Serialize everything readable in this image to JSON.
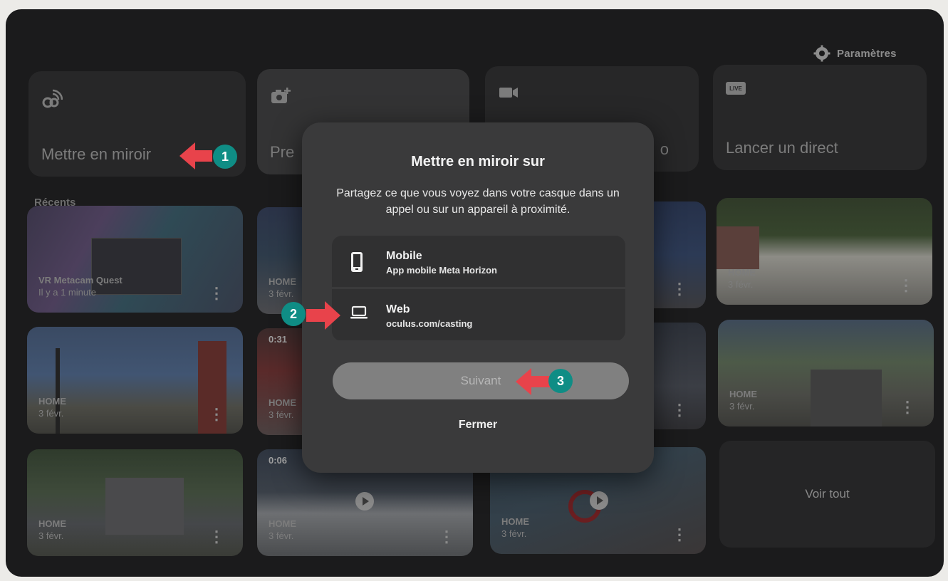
{
  "header": {
    "settings_label": "Paramètres",
    "settings_icon": "gear-icon"
  },
  "tiles": [
    {
      "label": "Mettre en miroir",
      "icon": "cast-icon"
    },
    {
      "label": "Pre",
      "icon": "camera-add-icon"
    },
    {
      "label": "o",
      "icon": "video-camera-icon"
    },
    {
      "label": "Lancer un direct",
      "icon": "live-icon",
      "icon_text": "LIVE"
    }
  ],
  "recents_label": "Récents",
  "thumbs": [
    {
      "title": "VR Metacam Quest",
      "date": "Il y a 1 minute"
    },
    {
      "title": "HOME",
      "date": "3 févr."
    },
    {
      "title": "HOME",
      "date": "3 févr."
    },
    {
      "title": "HOME",
      "date": "3 févr."
    },
    {
      "title": "HOME",
      "date": "3 févr.",
      "duration": "0:31"
    },
    {
      "title": "HOME",
      "date": "3 févr."
    },
    {
      "title": "HOME",
      "date": "3 févr."
    },
    {
      "title": "HOME",
      "date": "3 févr.",
      "duration": "0:06"
    },
    {
      "title": "HOME",
      "date": "3 févr."
    }
  ],
  "see_all": "Voir tout",
  "dialog": {
    "title": "Mettre en miroir sur",
    "description": "Partagez ce que vous voyez dans votre casque dans un appel ou sur un appareil à proximité.",
    "options": [
      {
        "name": "Mobile",
        "sub": "App mobile Meta Horizon",
        "icon": "phone-icon"
      },
      {
        "name": "Web",
        "sub": "oculus.com/casting",
        "icon": "laptop-icon"
      }
    ],
    "next_label": "Suivant",
    "close_label": "Fermer"
  },
  "callouts": [
    "1",
    "2",
    "3"
  ],
  "colors": {
    "badge": "#0f8d85",
    "arrow": "#e8434b"
  }
}
